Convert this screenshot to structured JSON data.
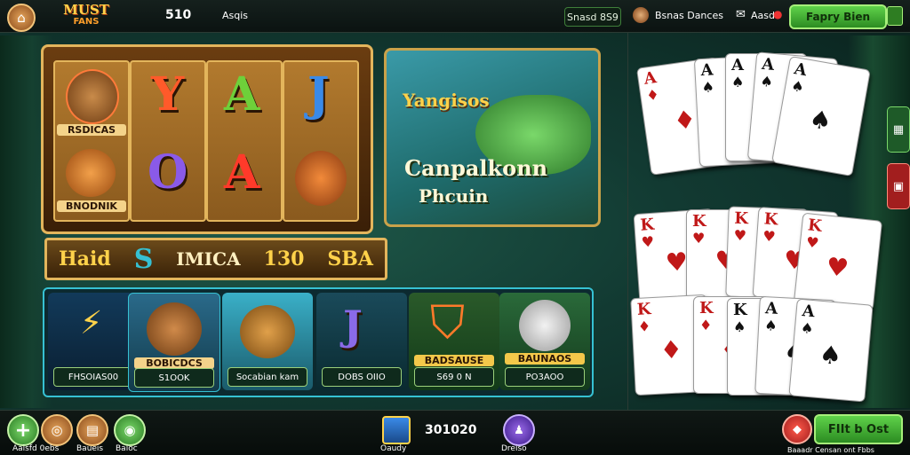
{
  "header": {
    "logo_line1": "MUST",
    "logo_line2": "FANS",
    "balance": "510",
    "label2": "Asqis",
    "pill1": "Snasd 8S9",
    "pill2": "Bsnas Dances",
    "pill3": "Aasd",
    "cta": "Fapry Bien"
  },
  "slots": {
    "left_top": "RSDICAS",
    "left_bottom": "BNODNIK",
    "letters": [
      "Y",
      "A",
      "J",
      "O",
      "A"
    ]
  },
  "promo": {
    "title": "Yangisos",
    "line1": "Canpalkonn",
    "line2": "Phcuin"
  },
  "banner": {
    "w1": "Haid",
    "w2": "S",
    "w3": "IMICA",
    "w4": "130",
    "w5": "SBA"
  },
  "tiles": [
    {
      "cap": "FHSOIAS00",
      "icon": "bolt-icon"
    },
    {
      "cap": "S1OOK",
      "badge": "BOBICDCS"
    },
    {
      "cap": "Socabian kam"
    },
    {
      "cap": "DOBS OIIO",
      "letter": "J"
    },
    {
      "cap": "S69 0 N",
      "badge": "BADSAUSE"
    },
    {
      "cap": "PO3AOO",
      "badge": "BAUNAOS"
    }
  ],
  "cards_top": [
    {
      "rank": "A",
      "suit": "♦",
      "color": "red"
    },
    {
      "rank": "A",
      "suit": "♠",
      "color": "black"
    },
    {
      "rank": "A",
      "suit": "♠",
      "color": "black"
    },
    {
      "rank": "A",
      "suit": "♠",
      "color": "black"
    },
    {
      "rank": "A",
      "suit": "♠",
      "color": "black"
    }
  ],
  "cards_mid": [
    {
      "rank": "K",
      "suit": "♥"
    },
    {
      "rank": "K",
      "suit": "♥"
    },
    {
      "rank": "K",
      "suit": "♥"
    },
    {
      "rank": "K",
      "suit": "♥"
    },
    {
      "rank": "K",
      "suit": "♥"
    }
  ],
  "cards_bot": [
    {
      "rank": "K",
      "suit": "♦"
    },
    {
      "rank": "K",
      "suit": "♦"
    },
    {
      "rank": "K",
      "suit": "♠"
    },
    {
      "rank": "A",
      "suit": "♠"
    },
    {
      "rank": "A",
      "suit": "♠"
    }
  ],
  "footer": {
    "add_label": "Aaisfd 0ebs",
    "btn2_label": "Baueis",
    "btn3_label": "Baioc",
    "center_label": "Oaudy",
    "credits": "301020",
    "center2_label": "Dreiso",
    "right_label": "Baaadr Censan ont Fbbs",
    "play": "FIIt b Ost"
  },
  "colors": {
    "accent": "#5fd24a",
    "gold": "#e3b55c",
    "teal": "#36c1d3"
  }
}
